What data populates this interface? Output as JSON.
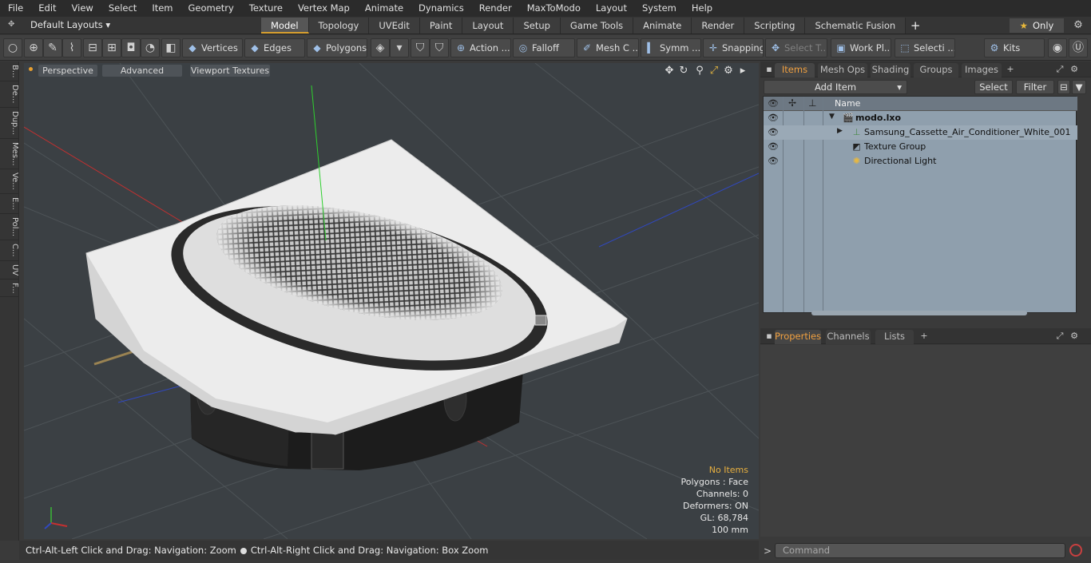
{
  "menu": [
    "File",
    "Edit",
    "View",
    "Select",
    "Item",
    "Geometry",
    "Texture",
    "Vertex Map",
    "Animate",
    "Dynamics",
    "Render",
    "MaxToModo",
    "Layout",
    "System",
    "Help"
  ],
  "layout_selector": "Default Layouts ▾",
  "mode_tabs": [
    "Model",
    "Topology",
    "UVEdit",
    "Paint",
    "Layout",
    "Setup",
    "Game Tools",
    "Animate",
    "Render",
    "Scripting",
    "Schematic Fusion"
  ],
  "active_tab": "Model",
  "only_label": "Only",
  "toolbar": {
    "vertices": "Vertices",
    "edges": "Edges",
    "polygons": "Polygons",
    "action": "Action ...",
    "falloff": "Falloff",
    "mesh": "Mesh C ...",
    "symm": "Symm ...",
    "snapping": "Snapping",
    "select_t": "Select T...",
    "work_pl": "Work Pl...",
    "selecti": "Selecti ...",
    "kits": "Kits"
  },
  "left_tabs": [
    "B...",
    "De...",
    "Dup...",
    "Mes...",
    "Ve...",
    "E...",
    "Pol...",
    "C...",
    "UV",
    "F..."
  ],
  "viewport": {
    "perspective": "Perspective",
    "advanced": "Advanced",
    "textures": "Viewport Textures",
    "info": {
      "items": "No Items",
      "polygons": "Polygons : Face",
      "channels": "Channels: 0",
      "deformers": "Deformers: ON",
      "gl": "GL: 68,784",
      "scale": "100 mm"
    }
  },
  "status": {
    "left": "Ctrl-Alt-Left Click and Drag: Navigation: Zoom",
    "right": "Ctrl-Alt-Right Click and Drag: Navigation: Box Zoom"
  },
  "items_panel": {
    "tabs": [
      "Items",
      "Mesh Ops",
      "Shading",
      "Groups",
      "Images"
    ],
    "add_item": "Add Item",
    "select": "Select",
    "filter": "Filter",
    "name_header": "Name",
    "tree": [
      {
        "label": "modo.lxo",
        "bold": true
      },
      {
        "label": "Samsung_Cassette_Air_Conditioner_White_001"
      },
      {
        "label": "Texture Group"
      },
      {
        "label": "Directional Light"
      }
    ]
  },
  "properties_panel": {
    "tabs": [
      "Properties",
      "Channels",
      "Lists"
    ]
  },
  "command_placeholder": "Command",
  "colors": {
    "accent": "#e8a030",
    "viewport_bg": "#3b4044",
    "list_bg": "#8f9fad"
  }
}
